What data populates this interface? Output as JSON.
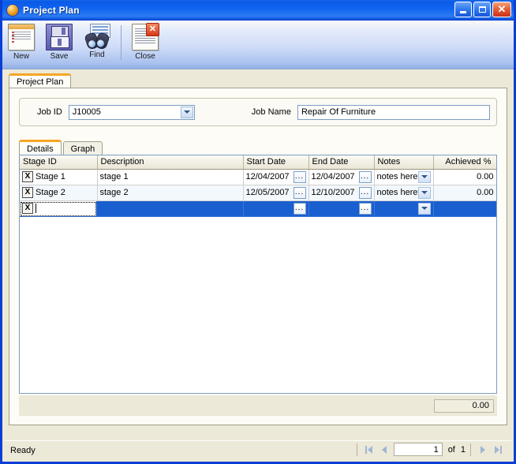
{
  "window": {
    "title": "Project Plan",
    "icon": "app-globe-icon",
    "buttons": {
      "minimize": "_",
      "maximize": "□",
      "close": "✕"
    }
  },
  "toolbar": {
    "items": [
      {
        "label": "New",
        "icon": "new-document-icon"
      },
      {
        "label": "Save",
        "icon": "floppy-disk-save-icon"
      },
      {
        "label": "Find",
        "icon": "binoculars-find-icon"
      },
      {
        "label": "Close",
        "icon": "close-window-icon"
      }
    ]
  },
  "outer_tab": {
    "label": "Project Plan"
  },
  "job": {
    "id_label": "Job ID",
    "id_value": "J10005",
    "name_label": "Job Name",
    "name_value": "Repair Of Furniture"
  },
  "inner_tabs": [
    {
      "label": "Details",
      "active": true
    },
    {
      "label": "Graph",
      "active": false
    }
  ],
  "grid": {
    "columns": [
      "Stage ID",
      "Description",
      "Start Date",
      "End Date",
      "Notes",
      "Achieved %"
    ],
    "rows": [
      {
        "delete_glyph": "X",
        "stage_id": "Stage 1",
        "description": "stage 1",
        "start_date": "12/04/2007",
        "end_date": "12/04/2007",
        "notes": "notes here",
        "achieved": "0.00",
        "selected": false
      },
      {
        "delete_glyph": "X",
        "stage_id": "Stage 2",
        "description": "stage 2",
        "start_date": "12/05/2007",
        "end_date": "12/10/2007",
        "notes": "notes here",
        "achieved": "0.00",
        "selected": false
      },
      {
        "delete_glyph": "X",
        "stage_id": "",
        "description": "",
        "start_date": "",
        "end_date": "",
        "notes": "",
        "achieved": "",
        "selected": true
      }
    ],
    "ellipsis_label": "...",
    "total": "0.00"
  },
  "status": {
    "message": "Ready",
    "page_value": "1",
    "of_label": "of",
    "page_count": "1"
  },
  "colors": {
    "title_bar": "#0f62ef",
    "window_border": "#0a3fd6",
    "selection": "#1a5fd0",
    "tab_accent": "#f5a623",
    "panel": "#ece9d8"
  }
}
